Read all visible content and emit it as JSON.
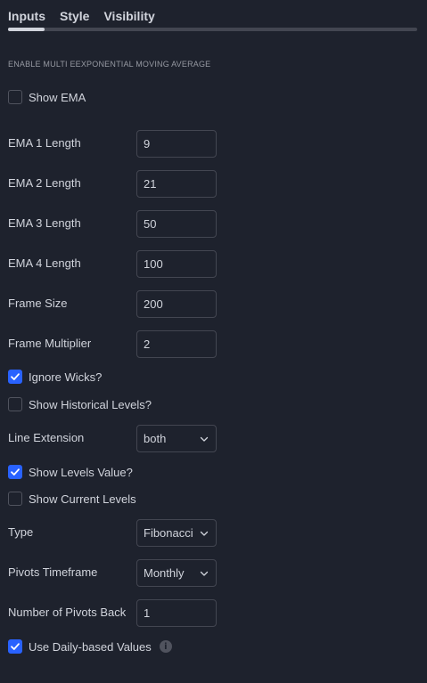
{
  "tabs": [
    {
      "label": "Inputs",
      "active": true
    },
    {
      "label": "Style",
      "active": false
    },
    {
      "label": "Visibility",
      "active": false
    }
  ],
  "section_title": "ENABLE MULTI EEXPONENTIAL MOVING AVERAGE",
  "show_ema": {
    "label": "Show EMA",
    "checked": false
  },
  "ema1": {
    "label": "EMA 1 Length",
    "value": "9"
  },
  "ema2": {
    "label": "EMA 2 Length",
    "value": "21"
  },
  "ema3": {
    "label": "EMA 3 Length",
    "value": "50"
  },
  "ema4": {
    "label": "EMA 4 Length",
    "value": "100"
  },
  "frame_size": {
    "label": "Frame Size",
    "value": "200"
  },
  "frame_multiplier": {
    "label": "Frame Multiplier",
    "value": "2"
  },
  "ignore_wicks": {
    "label": "Ignore Wicks?",
    "checked": true
  },
  "show_historical": {
    "label": "Show Historical Levels?",
    "checked": false
  },
  "line_extension": {
    "label": "Line Extension",
    "value": "both"
  },
  "show_levels_value": {
    "label": "Show Levels Value?",
    "checked": true
  },
  "show_current_levels": {
    "label": "Show Current Levels",
    "checked": false
  },
  "type": {
    "label": "Type",
    "value": "Fibonacci"
  },
  "pivots_timeframe": {
    "label": "Pivots Timeframe",
    "value": "Monthly"
  },
  "pivots_back": {
    "label": "Number of Pivots Back",
    "value": "1"
  },
  "daily_based": {
    "label": "Use Daily-based Values",
    "checked": true,
    "info_icon": "info-icon"
  },
  "colors": {
    "accent": "#2962ff",
    "background": "#1e222d",
    "text": "#d1d4dc"
  }
}
